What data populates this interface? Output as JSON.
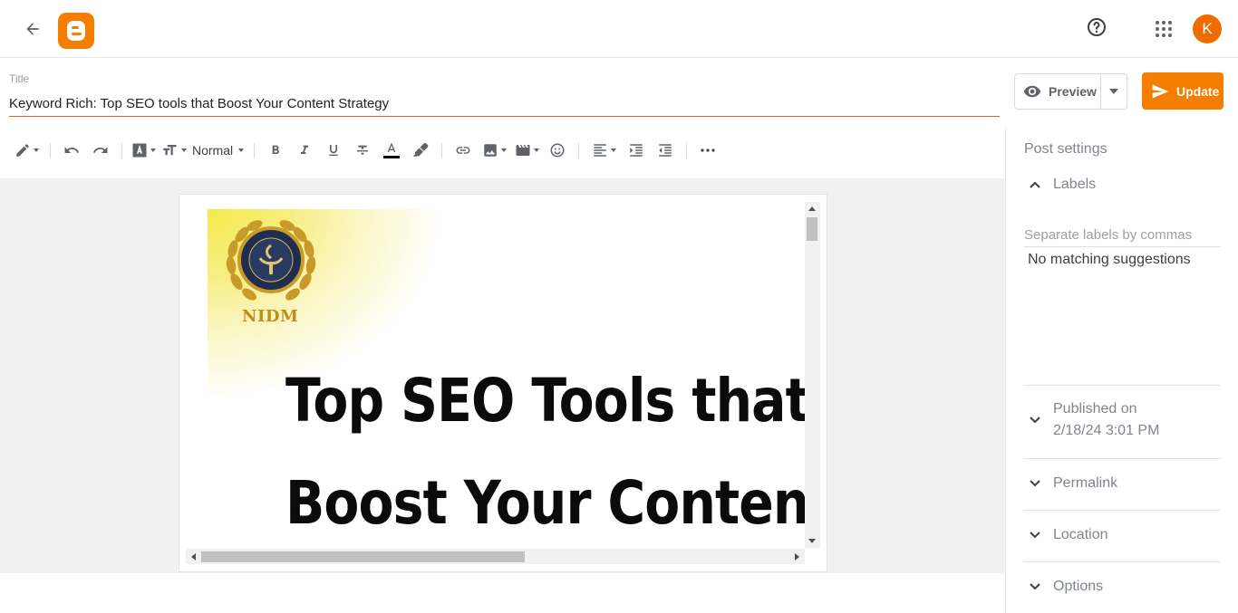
{
  "header": {
    "back_icon": "arrow-left-icon",
    "logo_icon": "blogger-logo-icon",
    "help_icon": "help-circle-icon",
    "apps_icon": "apps-grid-icon",
    "avatar_initial": "K",
    "brand_color": "#f57d00"
  },
  "title": {
    "label": "Title",
    "value": "Keyword Rich: Top SEO tools that Boost Your Content Strategy"
  },
  "actions": {
    "preview_label": "Preview",
    "update_label": "Update"
  },
  "toolbar": {
    "paragraph_style": "Normal",
    "buttons": [
      "pencil-mode",
      "undo",
      "redo",
      "font-family",
      "font-size",
      "bold",
      "italic",
      "underline",
      "strikethrough",
      "text-color",
      "highlight",
      "link",
      "insert-image",
      "insert-video",
      "emoji",
      "align",
      "indent",
      "outdent",
      "more"
    ]
  },
  "editor": {
    "banner_headline_1": "Top SEO Tools that",
    "banner_headline_2": "Boost Your Content",
    "banner_logo_text": "NIDM"
  },
  "sidebar": {
    "title": "Post settings",
    "labels": {
      "heading": "Labels",
      "placeholder": "Separate labels by commas",
      "no_match": "No matching suggestions"
    },
    "published_label": "Published on",
    "published_value": "2/18/24 3:01 PM",
    "permalink": "Permalink",
    "location": "Location",
    "options": "Options"
  }
}
